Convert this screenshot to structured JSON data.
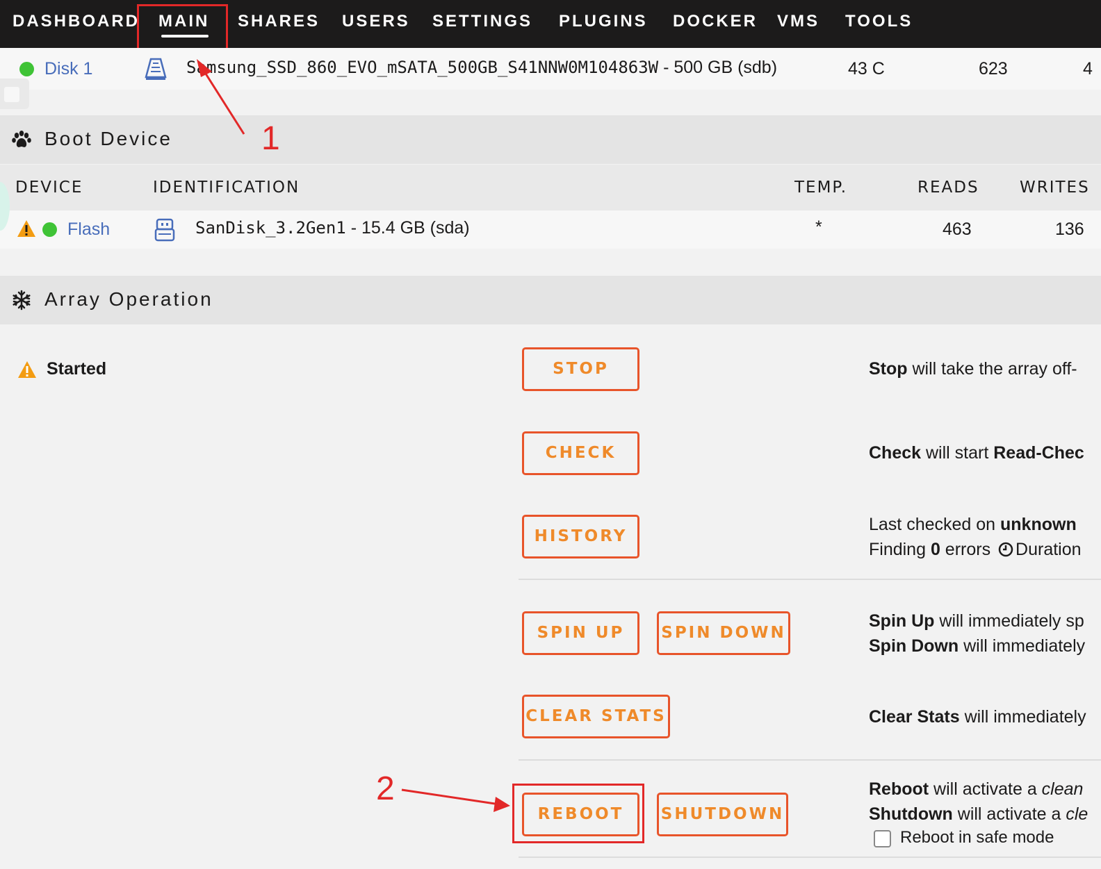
{
  "nav": {
    "items": [
      "DASHBOARD",
      "MAIN",
      "SHARES",
      "USERS",
      "SETTINGS",
      "PLUGINS",
      "DOCKER",
      "VMS",
      "TOOLS"
    ]
  },
  "disk_row": {
    "name": "Disk 1",
    "id_prefix": "Samsung_SSD_860_EVO_mSATA_500GB_S41NNW0M104863W",
    "id_suffix": " - 500 GB (sdb)",
    "temp": "43 C",
    "reads": "623",
    "extra": "4"
  },
  "boot_device": {
    "title": "Boot Device",
    "headers": {
      "device": "DEVICE",
      "identification": "IDENTIFICATION",
      "temp": "TEMP.",
      "reads": "READS",
      "writes": "WRITES"
    },
    "row": {
      "name": "Flash",
      "id_prefix": "SanDisk_3.2Gen1",
      "id_suffix": " - 15.4 GB (sda)",
      "temp": "*",
      "reads": "463",
      "writes": "136"
    }
  },
  "array_operation": {
    "title": "Array Operation",
    "status": "Started",
    "buttons": {
      "stop": "STOP",
      "check": "CHECK",
      "history": "HISTORY",
      "spin_up": "SPIN UP",
      "spin_down": "SPIN DOWN",
      "clear_stats": "CLEAR STATS",
      "reboot": "REBOOT",
      "shutdown": "SHUTDOWN"
    },
    "desc": {
      "stop_b": "Stop",
      "stop_t": " will take the array off-",
      "check_b": "Check",
      "check_t": " will start ",
      "check_b2": "Read-Chec",
      "last_t": "Last checked on ",
      "last_b": "unknown",
      "finding_t": "Finding ",
      "finding_b": "0",
      "finding_t2": " errors ",
      "duration_t": "Duration",
      "spinup_b": "Spin Up",
      "spinup_t": " will immediately sp",
      "spindown_b": "Spin Down",
      "spindown_t": " will immediately",
      "clear_b": "Clear Stats",
      "clear_t": " will immediately",
      "reboot_b": "Reboot",
      "reboot_t": " will activate a ",
      "reboot_i": "clean",
      "shutdown_b": "Shutdown",
      "shutdown_t": " will activate a ",
      "shutdown_i": "cle",
      "safe_mode": "Reboot in safe mode"
    }
  },
  "annotations": {
    "one": "1",
    "two": "2"
  },
  "colors": {
    "accent": "#ef8a2a",
    "button_border": "#e8542a",
    "annotation": "#e22828",
    "online": "#3fc336",
    "link": "#486dba"
  }
}
